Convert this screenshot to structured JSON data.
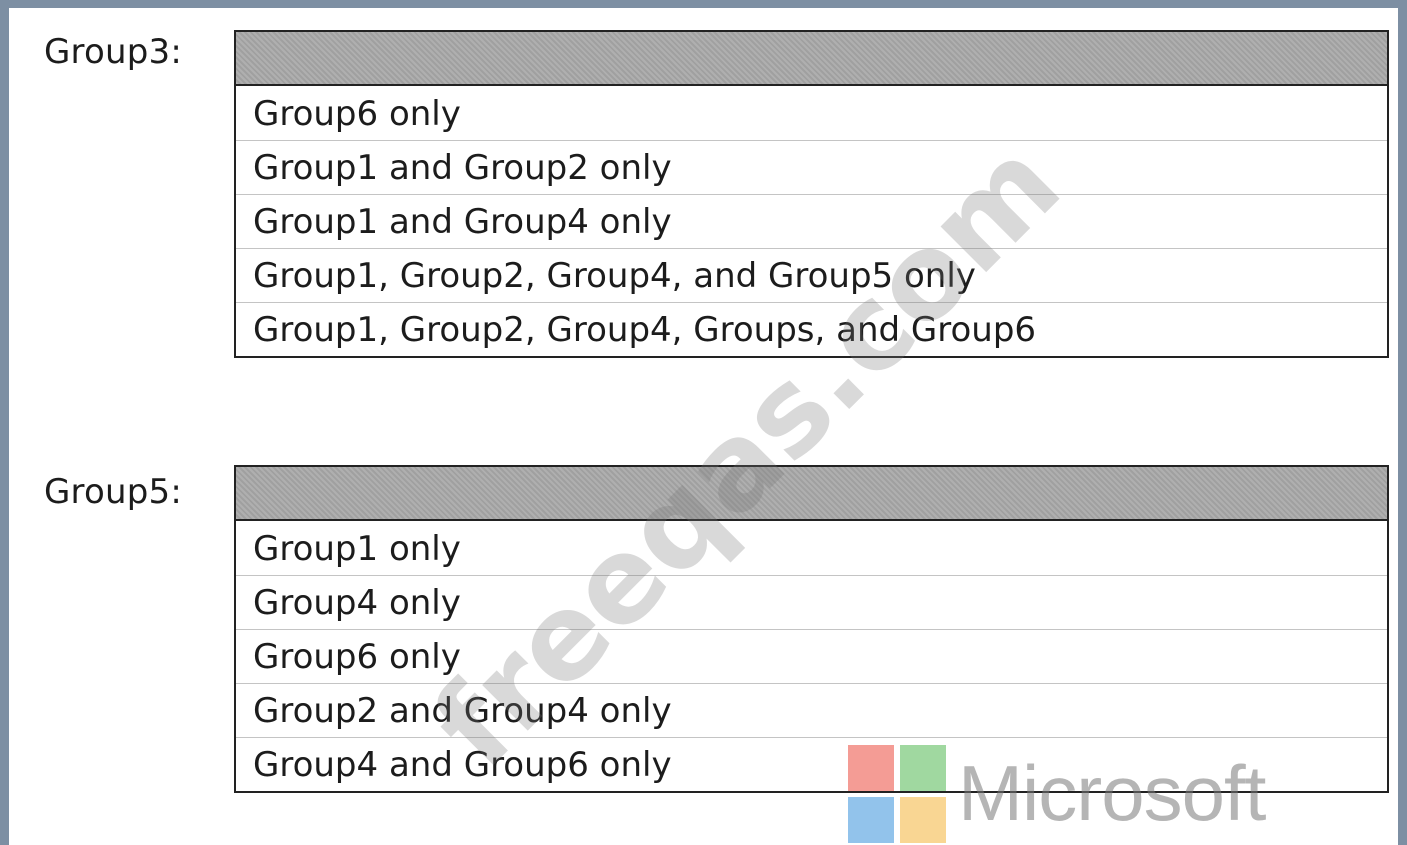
{
  "groups": [
    {
      "label": "Group3:",
      "selected": "",
      "options": [
        "Group6 only",
        "Group1 and Group2 only",
        "Group1 and Group4 only",
        "Group1, Group2, Group4, and Group5 only",
        "Group1, Group2, Group4, Groups, and Group6"
      ]
    },
    {
      "label": "Group5:",
      "selected": "",
      "options": [
        "Group1 only",
        "Group4 only",
        "Group6 only",
        "Group2 and Group4 only",
        "Group4 and Group6 only"
      ]
    }
  ],
  "watermark": {
    "text": "freeqas.com"
  },
  "logo": {
    "wordmark": "Microsoft",
    "colors": [
      "#f28b82",
      "#8fd18f",
      "#7fb8e8",
      "#f8cf80"
    ]
  }
}
